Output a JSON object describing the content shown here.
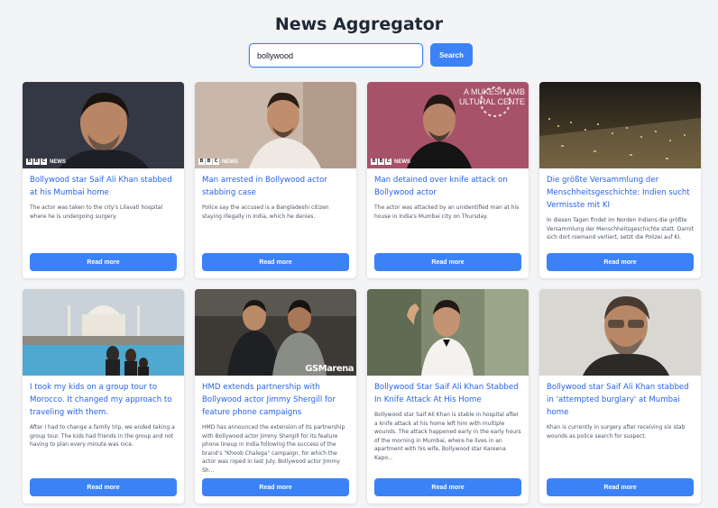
{
  "page": {
    "title": "News Aggregator"
  },
  "search": {
    "value": "bollywood",
    "button_label": "Search"
  },
  "articles": [
    {
      "title": "Bollywood star Saif Ali Khan stabbed at his Mumbai home",
      "description": "The actor was taken to the city's Lilavati hospital where he is undergoing surgery.",
      "button_label": "Read more",
      "image_logo": "NEWS"
    },
    {
      "title": "Man arrested in Bollywood actor stabbing case",
      "description": "Police say the accused is a Bangladeshi citizen staying illegally in India, which he denies.",
      "button_label": "Read more",
      "image_logo": "NEWS"
    },
    {
      "title": "Man detained over knife attack on Bollywood actor",
      "description": "The actor was attacked by an unidentified man at his house in India's Mumbai city on Thursday.",
      "button_label": "Read more",
      "image_logo": "NEWS",
      "image_text": "A MUKESH AMB\nULTURAL CENTE"
    },
    {
      "title": "Die größte Versammlung der Menschheitsgeschichte: Indien sucht Vermisste mit KI",
      "description": "In diesen Tagen findet im Norden Indiens die größte Versammlung der Menschheitsgeschichte statt. Damit sich dort niemand verliert, setzt die Polizei auf KI.",
      "button_label": "Read more"
    },
    {
      "title": "I took my kids on a group tour to Morocco. It changed my approach to traveling with them.",
      "description": "After I had to change a family trip, we ended taking a group tour. The kids had friends in the group and not having to plan every minute was nice.",
      "button_label": "Read more"
    },
    {
      "title": "HMD extends partnership with Bollywood actor Jimmy Shergill for feature phone campaigns",
      "description": "HMD has announced the extension of its partnership with Bollywood actor Jimmy Shergill for its feature phone lineup in India following the success of the brand's \"Khoob Chalega\" campaign, for which the actor was roped in last July. Bollywood actor Jimmy Sh...",
      "button_label": "Read more",
      "image_logo": "GSMarena"
    },
    {
      "title": "Bollywood Star Saif Ali Khan Stabbed In Knife Attack At His Home",
      "description": "Bollywood star Saif Ali Khan is stable in hospital after a knife attack at his home left him with multiple wounds. The attack happened early in the early hours of the morning in Mumbai, where he lives in an apartment with his wife, Bollywood star Kareena Kapo...",
      "button_label": "Read more"
    },
    {
      "title": "Bollywood star Saif Ali Khan stabbed in 'attempted burglary' at Mumbai home",
      "description": "Khan is currently in surgery after receiving six stab wounds as police search for suspect.",
      "button_label": "Read more"
    }
  ],
  "colors": {
    "accent": "#3b82f6",
    "link": "#2563eb",
    "background": "#f3f4f6"
  }
}
